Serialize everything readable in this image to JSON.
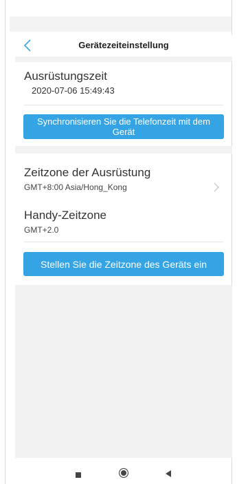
{
  "header": {
    "title": "Gerätezeiteinstellung",
    "back_icon": "chevron-left-icon"
  },
  "device_time": {
    "label": "Ausrüstungszeit",
    "value": "2020-07-06 15:49:43",
    "sync_button_label": "Synchronisieren Sie die Telefonzeit mit dem Gerät"
  },
  "device_timezone": {
    "label": "Zeitzone der Ausrüstung",
    "value": "GMT+8:00 Asia/Hong_Kong",
    "chevron_icon": "chevron-right-icon"
  },
  "phone_timezone": {
    "label": "Handy-Zeitzone",
    "value": "GMT+2.0"
  },
  "set_timezone_button_label": "Stellen Sie die Zeitzone des Geräts ein",
  "system_nav": {
    "recent_icon": "square-icon",
    "home_icon": "circle-icon",
    "back_icon": "triangle-back-icon"
  },
  "colors": {
    "accent": "#35a4e4",
    "background_gray": "#f2f2f2"
  }
}
